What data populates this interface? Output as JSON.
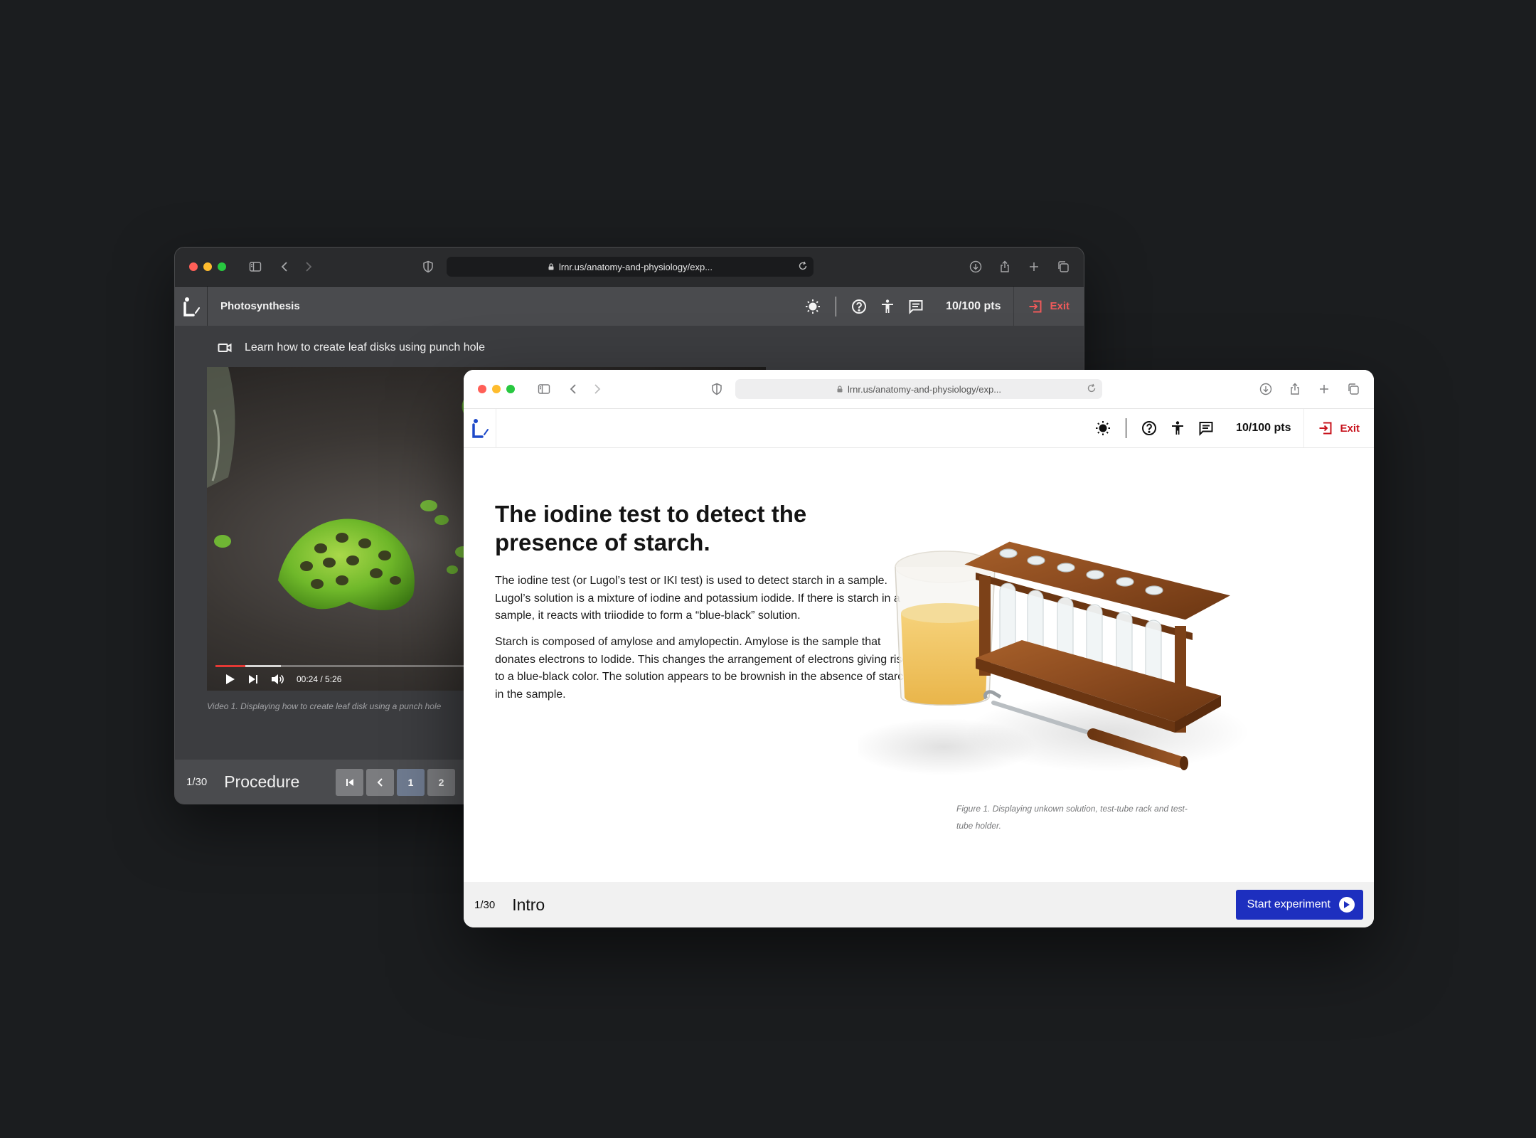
{
  "back_window": {
    "url": "lrnr.us/anatomy-and-physiology/exp...",
    "app_title": "Photosynthesis",
    "points": "10/100 pts",
    "exit_label": "Exit",
    "video_title": "Learn how to create leaf disks using punch hole",
    "video_time": "00:24 / 5:26",
    "video_progress": 0.075,
    "video_caption": "Video 1. Displaying how to create leaf disk using a punch hole",
    "footer_counter": "1/30",
    "footer_section": "Procedure",
    "pager": [
      "1",
      "2"
    ]
  },
  "front_window": {
    "url": "lrnr.us/anatomy-and-physiology/exp...",
    "points": "10/100 pts",
    "exit_label": "Exit",
    "title": "The iodine test to detect the presence of starch.",
    "paragraph_1": "The iodine test (or Lugol’s test or IKI test) is used to detect starch in a sample. Lugol’s solution is a mixture of iodine and potassium iodide. If there is starch in a sample, it reacts with triiodide to form a “blue-black” solution.",
    "paragraph_2": "Starch is composed of amylose and amylopectin. Amylose is the sample that donates electrons to Iodide. This changes the arrangement of electrons giving rise to a blue-black color. The solution appears to be brownish in the absence of starch in the sample.",
    "figure_caption": "Figure 1. Displaying unkown solution, test-tube rack and test-tube holder.",
    "footer_counter": "1/30",
    "footer_section": "Intro",
    "start_button": "Start experiment"
  },
  "colors": {
    "desktop_bg": "#1b1d1f",
    "primary_button": "#1d2fbf",
    "exit_dark": "#ef5a5a",
    "exit_light": "#c8141e",
    "video_progress": "#e53935"
  },
  "icons": [
    "sidebar-icon",
    "back-icon",
    "forward-icon",
    "shield-icon",
    "lock-icon",
    "reload-icon",
    "download-icon",
    "share-icon",
    "new-tab-icon",
    "tabs-overview-icon",
    "brightness-icon",
    "help-icon",
    "accessibility-icon",
    "chat-icon",
    "exit-icon",
    "video-camera-icon",
    "play-icon",
    "skip-next-icon",
    "volume-icon",
    "first-page-icon",
    "prev-page-icon",
    "arrow-right-circle-icon"
  ]
}
